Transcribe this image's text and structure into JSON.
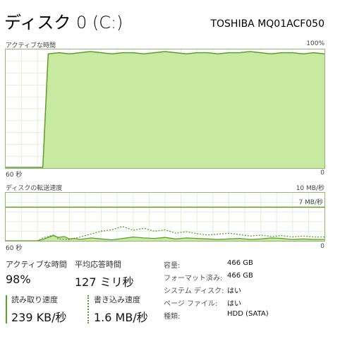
{
  "header": {
    "title": "ディスク 0 (C:)",
    "model": "TOSHIBA MQ01ACF050"
  },
  "active_chart": {
    "label": "アクティブな時間",
    "max_label": "100%",
    "x_left": "60 秒",
    "x_right": "0"
  },
  "transfer_chart": {
    "label": "ディスクの転送速度",
    "max_label": "10 MB/秒",
    "ref_label": "7 MB/秒",
    "x_left": "60 秒",
    "x_right": "0"
  },
  "stats": {
    "active_label": "アクティブな時間",
    "active_value": "98%",
    "resp_label": "平均応答時間",
    "resp_value": "127 ミリ秒",
    "read_label": "読み取り速度",
    "read_value": "239 KB/秒",
    "write_label": "書き込み速度",
    "write_value": "1.6 MB/秒"
  },
  "info": [
    {
      "label": "容量:",
      "value": "466 GB"
    },
    {
      "label": "フォーマット済み:",
      "value": "466 GB"
    },
    {
      "label": "システム ディスク:",
      "value": "はい"
    },
    {
      "label": "ページ ファイル:",
      "value": "はい"
    },
    {
      "label": "種類:",
      "value": "HDD (SATA)"
    }
  ],
  "colors": {
    "accent": "#5e9c2e",
    "fill": "#c8e9a0",
    "grid": "#e4efdb",
    "border": "#8fb96e"
  },
  "chart_data": [
    {
      "type": "area",
      "name": "active-time",
      "x_unit": "seconds ago",
      "ylim": [
        0,
        100
      ],
      "x": [
        60,
        54,
        53,
        52,
        50,
        48,
        46,
        44,
        42,
        40,
        38,
        36,
        34,
        32,
        30,
        28,
        26,
        24,
        22,
        20,
        18,
        16,
        14,
        12,
        10,
        8,
        6,
        4,
        2,
        0
      ],
      "values": [
        0,
        0,
        0,
        98,
        99,
        98,
        99,
        100,
        99,
        98,
        99,
        99,
        98,
        99,
        100,
        99,
        98,
        99,
        99,
        98,
        99,
        99,
        100,
        99,
        98,
        99,
        99,
        98,
        99,
        98
      ]
    },
    {
      "type": "line",
      "name": "transfer-rate",
      "x_unit": "seconds ago",
      "ylim": [
        0,
        10
      ],
      "reference_line": 7,
      "series": [
        {
          "style": "solid",
          "x": [
            60,
            54,
            53,
            51,
            50,
            49,
            48,
            47,
            46,
            44,
            42,
            40,
            38,
            36,
            34,
            32,
            30,
            28,
            26,
            24,
            22,
            20,
            18,
            16,
            14,
            12,
            10,
            8,
            6,
            4,
            2,
            0
          ],
          "values": [
            0,
            0,
            0.3,
            1.1,
            0.7,
            0.9,
            0.4,
            0.5,
            0.3,
            0.6,
            0.4,
            0.2,
            0.5,
            0.8,
            0.6,
            0.5,
            0.7,
            0.4,
            0.6,
            0.5,
            0.4,
            0.3,
            0.4,
            0.5,
            0.3,
            0.4,
            0.6,
            0.5,
            0.3,
            0.4,
            0.3,
            0.3
          ]
        },
        {
          "style": "dashed",
          "x": [
            60,
            54,
            53,
            51,
            50,
            48,
            46,
            44,
            42,
            40,
            38,
            36,
            34,
            32,
            30,
            28,
            26,
            24,
            22,
            20,
            18,
            16,
            14,
            12,
            10,
            8,
            6,
            4,
            2,
            0
          ],
          "values": [
            0,
            0,
            0.6,
            1.2,
            0.4,
            0.3,
            0.8,
            1.4,
            2.0,
            2.3,
            3.0,
            2.2,
            2.6,
            2.0,
            2.3,
            1.6,
            1.9,
            1.5,
            1.2,
            1.4,
            1.6,
            1.3,
            1.0,
            1.2,
            0.9,
            1.1,
            0.8,
            1.0,
            0.8,
            0.8
          ]
        }
      ]
    }
  ]
}
